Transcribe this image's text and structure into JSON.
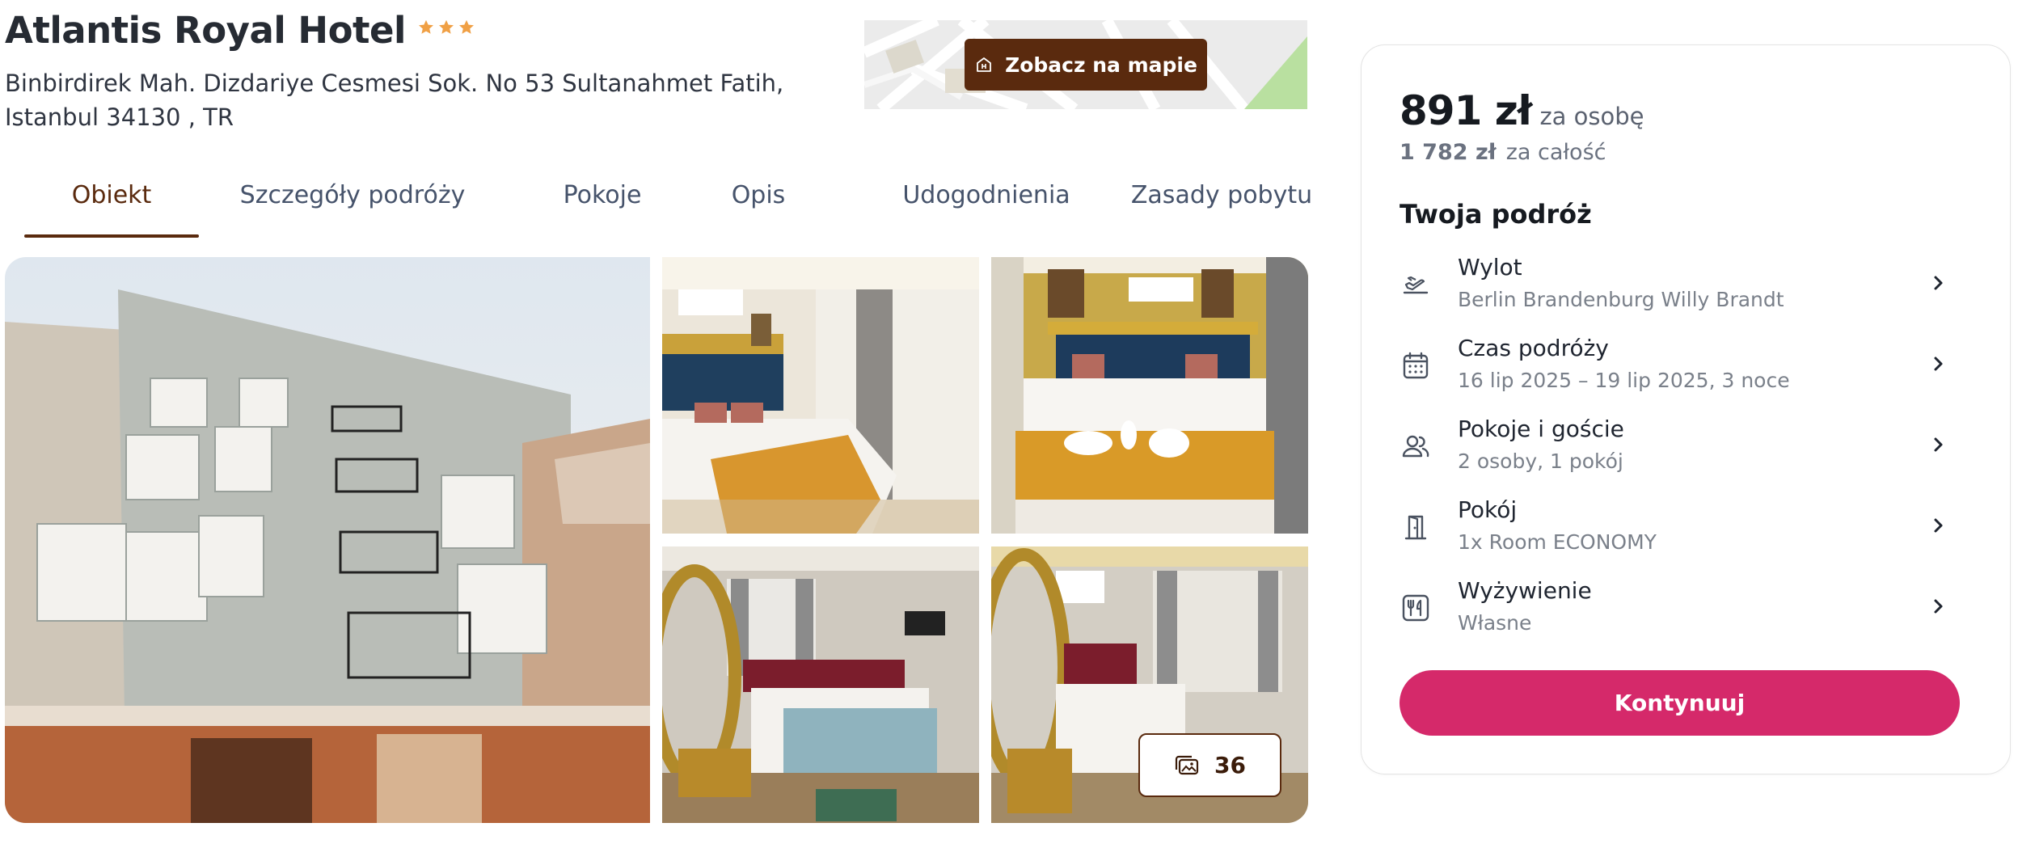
{
  "hotel": {
    "name": "Atlantis Royal Hotel",
    "stars": 3,
    "address": "Binbirdirek Mah. Dizdariye Cesmesi Sok. No 53 Sultanahmet Fatih, Istanbul 34130 , TR"
  },
  "map": {
    "button_label": "Zobacz na mapie"
  },
  "tabs": [
    {
      "label": "Obiekt",
      "active": true
    },
    {
      "label": "Szczegóły podróży",
      "active": false
    },
    {
      "label": "Pokoje",
      "active": false
    },
    {
      "label": "Opis",
      "active": false
    },
    {
      "label": "Udogodnienia",
      "active": false
    },
    {
      "label": "Zasady pobytu",
      "active": false
    }
  ],
  "gallery": {
    "photo_count": "36"
  },
  "booking": {
    "price": "891 zł",
    "price_unit": "za osobę",
    "total": "1 782 zł",
    "total_unit": "za całość",
    "trip_title": "Twoja podróż",
    "items": [
      {
        "label": "Wylot",
        "value": "Berlin Brandenburg Willy Brandt",
        "icon": "plane-departure-icon"
      },
      {
        "label": "Czas podróży",
        "value": "16 lip 2025 – 19 lip 2025, 3 noce",
        "icon": "calendar-icon"
      },
      {
        "label": "Pokoje i goście",
        "value": "2 osoby, 1 pokój",
        "icon": "users-icon"
      },
      {
        "label": "Pokój",
        "value": "1x Room ECONOMY",
        "icon": "door-icon"
      },
      {
        "label": "Wyżywienie",
        "value": "Własne",
        "icon": "fork-knife-icon"
      }
    ],
    "continue_label": "Kontynuuj"
  },
  "colors": {
    "brand_brown": "#5a2a0e",
    "accent_pink": "#d5296a",
    "star_orange": "#f0a045"
  }
}
